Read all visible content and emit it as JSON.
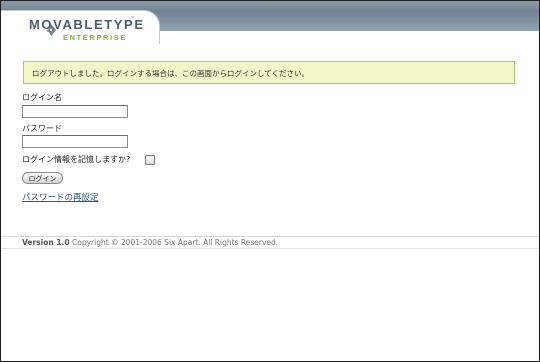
{
  "header": {
    "logo_text": "MOVABLETYPE",
    "logo_tm": "™",
    "logo_subtitle": "ENTERPRISE",
    "colors": {
      "strip": "#6f8191",
      "logo": "#4f5d68",
      "subtitle": "#8ab13b"
    },
    "logo_icon": "pen-nib-icon"
  },
  "message": {
    "text": "ログアウトしました。ログインする場合は、この画面からログインしてください。",
    "background": "#f2f7c9",
    "border": "#b2c56a"
  },
  "form": {
    "username_label": "ログイン名",
    "username_value": "",
    "password_label": "パスワード",
    "password_value": "",
    "remember_label": "ログイン情報を記憶しますか?",
    "remember_checked": false,
    "login_button": "ログイン",
    "reset_link": "パスワードの再設定",
    "link_color": "#33567f"
  },
  "footer": {
    "version": "Version 1.0",
    "copyright": "Copyright © 2001-2006 Six Apart. All Rights Reserved."
  }
}
